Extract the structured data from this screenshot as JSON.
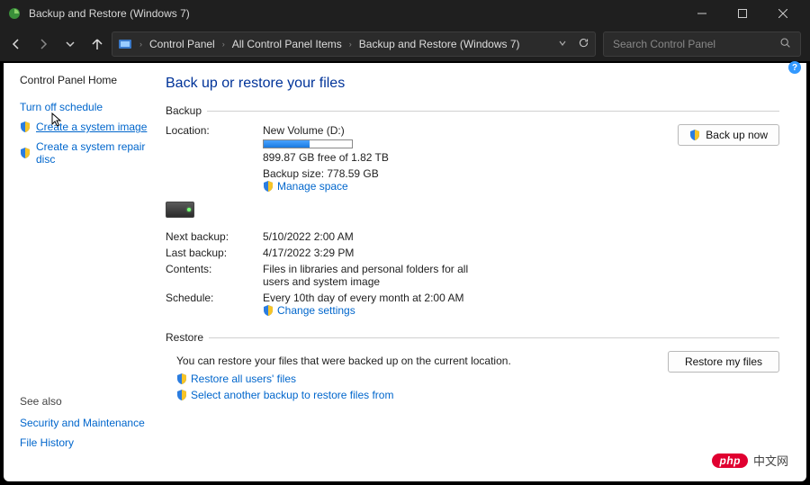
{
  "window": {
    "title": "Backup and Restore (Windows 7)"
  },
  "breadcrumbs": [
    "Control Panel",
    "All Control Panel Items",
    "Backup and Restore (Windows 7)"
  ],
  "search": {
    "placeholder": "Search Control Panel"
  },
  "sidebar": {
    "home": "Control Panel Home",
    "items": [
      {
        "label": "Turn off schedule",
        "shield": false
      },
      {
        "label": "Create a system image",
        "shield": true,
        "active": true
      },
      {
        "label": "Create a system repair disc",
        "shield": true
      }
    ],
    "seealso_header": "See also",
    "seealso": [
      "Security and Maintenance",
      "File History"
    ]
  },
  "main": {
    "heading": "Back up or restore your files",
    "backup_legend": "Backup",
    "restore_legend": "Restore",
    "backup": {
      "location_label": "Location:",
      "location_value": "New Volume (D:)",
      "capacity_text": "899.87 GB free of 1.82 TB",
      "capacity_pct": 52,
      "size_text": "Backup size: 778.59 GB",
      "manage_link": "Manage space",
      "next_label": "Next backup:",
      "next_value": "5/10/2022 2:00 AM",
      "last_label": "Last backup:",
      "last_value": "4/17/2022 3:29 PM",
      "contents_label": "Contents:",
      "contents_value": "Files in libraries and personal folders for all users and system image",
      "schedule_label": "Schedule:",
      "schedule_value": "Every 10th day of every month at 2:00 AM",
      "change_link": "Change settings",
      "backup_btn": "Back up now"
    },
    "restore": {
      "text": "You can restore your files that were backed up on the current location.",
      "restore_all": "Restore all users' files",
      "select_another": "Select another backup to restore files from",
      "restore_btn": "Restore my files"
    }
  },
  "watermark": {
    "logo": "php",
    "text": "中文网"
  }
}
